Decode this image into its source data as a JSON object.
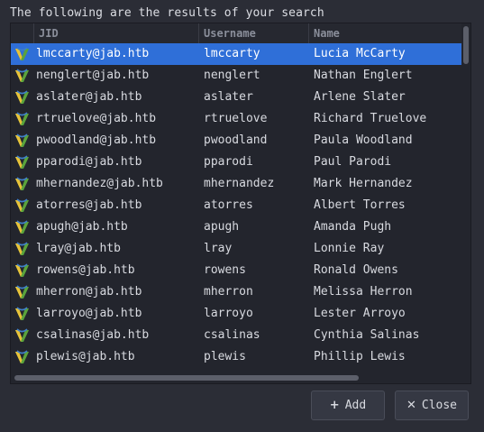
{
  "dialog": {
    "message": "The following are the results of your search"
  },
  "table": {
    "columns": [
      "JID",
      "Username",
      "Name"
    ],
    "rows": [
      {
        "jid": "lmccarty@jab.htb",
        "username": "lmccarty",
        "name": "Lucia McCarty",
        "selected": true
      },
      {
        "jid": "nenglert@jab.htb",
        "username": "nenglert",
        "name": "Nathan Englert"
      },
      {
        "jid": "aslater@jab.htb",
        "username": "aslater",
        "name": "Arlene Slater"
      },
      {
        "jid": "rtruelove@jab.htb",
        "username": "rtruelove",
        "name": "Richard Truelove"
      },
      {
        "jid": "pwoodland@jab.htb",
        "username": "pwoodland",
        "name": "Paula Woodland"
      },
      {
        "jid": "pparodi@jab.htb",
        "username": "pparodi",
        "name": "Paul Parodi"
      },
      {
        "jid": "mhernandez@jab.htb",
        "username": "mhernandez",
        "name": "Mark Hernandez"
      },
      {
        "jid": "atorres@jab.htb",
        "username": "atorres",
        "name": "Albert Torres"
      },
      {
        "jid": "apugh@jab.htb",
        "username": "apugh",
        "name": "Amanda Pugh"
      },
      {
        "jid": "lray@jab.htb",
        "username": "lray",
        "name": "Lonnie Ray"
      },
      {
        "jid": "rowens@jab.htb",
        "username": "rowens",
        "name": "Ronald Owens"
      },
      {
        "jid": "mherron@jab.htb",
        "username": "mherron",
        "name": "Melissa Herron"
      },
      {
        "jid": "larroyo@jab.htb",
        "username": "larroyo",
        "name": "Lester Arroyo"
      },
      {
        "jid": "csalinas@jab.htb",
        "username": "csalinas",
        "name": "Cynthia Salinas"
      },
      {
        "jid": "plewis@jab.htb",
        "username": "plewis",
        "name": "Phillip Lewis"
      }
    ],
    "row_icon": "jabber-user-icon"
  },
  "buttons": {
    "add_label": "Add",
    "add_icon": "plus-icon",
    "close_label": "Close",
    "close_icon": "x-icon"
  },
  "colors": {
    "selection": "#2f6fd8",
    "icon_yellow": "#e8c23a",
    "icon_green": "#5aa33c",
    "icon_blue": "#3f7fc8"
  }
}
